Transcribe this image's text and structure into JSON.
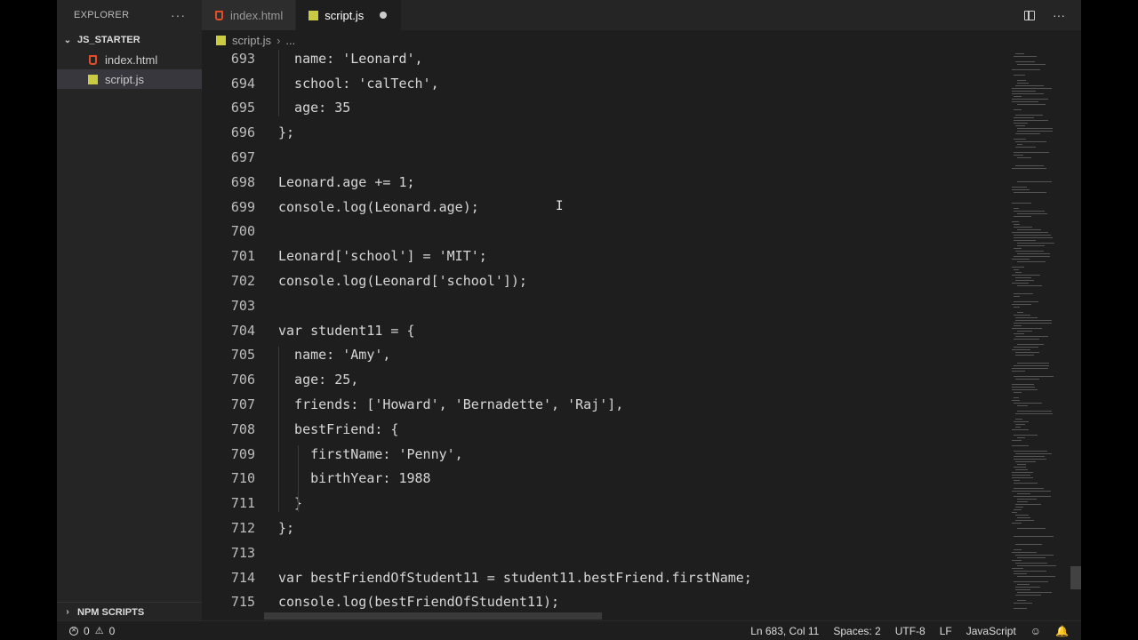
{
  "sidebar": {
    "title": "EXPLORER",
    "more": "···",
    "project": "JS_STARTER",
    "files": [
      {
        "name": "index.html",
        "type": "html"
      },
      {
        "name": "script.js",
        "type": "js"
      }
    ],
    "npm_scripts": "NPM SCRIPTS"
  },
  "tabs": [
    {
      "label": "index.html",
      "type": "html"
    },
    {
      "label": "script.js",
      "type": "js",
      "modified": true
    }
  ],
  "tab_more": "···",
  "breadcrumb": {
    "file": "script.js",
    "rest": "..."
  },
  "editor": {
    "lines": [
      {
        "n": "693",
        "code": "  name: 'Leonard',"
      },
      {
        "n": "694",
        "code": "  school: 'calTech',"
      },
      {
        "n": "695",
        "code": "  age: 35"
      },
      {
        "n": "696",
        "code": "};"
      },
      {
        "n": "697",
        "code": ""
      },
      {
        "n": "698",
        "code": "Leonard.age += 1;"
      },
      {
        "n": "699",
        "code": "console.log(Leonard.age);"
      },
      {
        "n": "700",
        "code": ""
      },
      {
        "n": "701",
        "code": "Leonard['school'] = 'MIT';"
      },
      {
        "n": "702",
        "code": "console.log(Leonard['school']);"
      },
      {
        "n": "703",
        "code": ""
      },
      {
        "n": "704",
        "code": "var student11 = {"
      },
      {
        "n": "705",
        "code": "  name: 'Amy',"
      },
      {
        "n": "706",
        "code": "  age: 25,"
      },
      {
        "n": "707",
        "code": "  friends: ['Howard', 'Bernadette', 'Raj'],"
      },
      {
        "n": "708",
        "code": "  bestFriend: {"
      },
      {
        "n": "709",
        "code": "    firstName: 'Penny',"
      },
      {
        "n": "710",
        "code": "    birthYear: 1988"
      },
      {
        "n": "711",
        "code": "  }"
      },
      {
        "n": "712",
        "code": "};"
      },
      {
        "n": "713",
        "code": ""
      },
      {
        "n": "714",
        "code": "var bestFriendOfStudent11 = student11.bestFriend.firstName;"
      },
      {
        "n": "715",
        "code": "console.log(bestFriendOfStudent11);"
      }
    ]
  },
  "status": {
    "errors": "0",
    "warnings": "0",
    "position": "Ln 683, Col 11",
    "spaces": "Spaces: 2",
    "encoding": "UTF-8",
    "eol": "LF",
    "language": "JavaScript"
  }
}
